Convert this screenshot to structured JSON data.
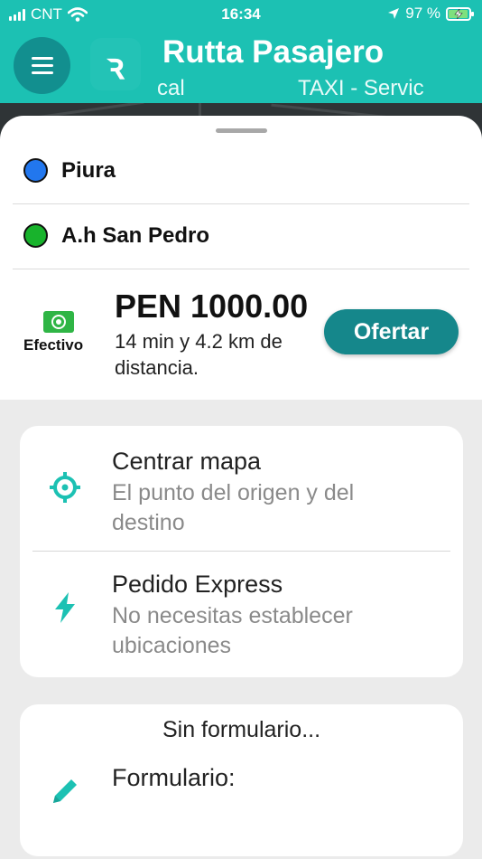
{
  "status_bar": {
    "carrier": "CNT",
    "time": "16:34",
    "battery_percent": "97 %",
    "battery_level": 0.97,
    "icons": [
      "signal-bars-icon",
      "wifi-icon",
      "location-arrow-icon",
      "battery-charging-icon"
    ]
  },
  "header": {
    "title": "Rutta Pasajero",
    "marquee_left": "cal",
    "marquee_right": "TAXI - Servic",
    "logo_glyph": "ꝛ",
    "color": "#1cc1b3"
  },
  "trip": {
    "origin": "Piura",
    "origin_color": "#2277ee",
    "destination": "A.h San Pedro",
    "destination_color": "#18b32c",
    "payment_label": "Efectivo",
    "price": "PEN 1000.00",
    "eta": "14 min y 4.2 km de distancia.",
    "offer_button": "Ofertar",
    "accent": "#15878b"
  },
  "options": {
    "center_map": {
      "title": "Centrar mapa",
      "subtitle": "El punto del origen y del destino",
      "icon": "crosshair-icon"
    },
    "express": {
      "title": "Pedido Express",
      "subtitle": "No necesitas establecer ubicaciones",
      "icon": "lightning-bolt-icon"
    }
  },
  "form_card": {
    "header": "Sin formulario...",
    "label": "Formulario:",
    "icon": "pencil-icon"
  }
}
